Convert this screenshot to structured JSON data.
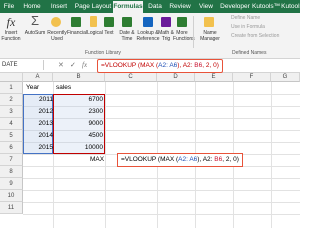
{
  "tabs": [
    "File",
    "Home",
    "Insert",
    "Page Layout",
    "Formulas",
    "Data",
    "Review",
    "View",
    "Developer",
    "Kutools™",
    "Kutools"
  ],
  "active_tab": "Formulas",
  "ribbon": {
    "insert_function": "Insert Function",
    "autosum": "AutoSum",
    "recently_used": "Recently Used",
    "financial": "Financial",
    "logical": "Logical",
    "text": "Text",
    "date_time": "Date & Time",
    "lookup_reference": "Lookup & Reference",
    "math_trig": "Math & Trig",
    "more_functions": "More Functions",
    "name_manager": "Name Manager",
    "function_library": "Function Library",
    "define_name": "Define Name",
    "use_in_formula": "Use in Formula",
    "create_from_selection": "Create from Selection",
    "defined_names": "Defined Names"
  },
  "formula_bar": {
    "name_box": "DATE",
    "cancel": "✕",
    "enter": "✓",
    "fx": "fx",
    "pre": "=VLOOKUP (MAX (",
    "range1": "A2: A6",
    "mid": "), A2: ",
    "range2": "B6",
    "post": ", 2, 0)"
  },
  "columns": [
    "A",
    "B",
    "C",
    "D",
    "E",
    "F",
    "G"
  ],
  "rows": [
    "1",
    "2",
    "3",
    "4",
    "5",
    "6",
    "7",
    "8",
    "9",
    "10",
    "11"
  ],
  "headers": {
    "a1": "Year",
    "b1": "sales"
  },
  "data": [
    {
      "year": "2011",
      "sales": "6700"
    },
    {
      "year": "2012",
      "sales": "2300"
    },
    {
      "year": "2013",
      "sales": "9000"
    },
    {
      "year": "2014",
      "sales": "4500"
    },
    {
      "year": "2015",
      "sales": "10000"
    }
  ],
  "max_label": "MAX",
  "cell_formula": {
    "pre": "=VLOOKUP (MAX (",
    "range1": "A2: A6",
    "mid": "), A2: ",
    "range2": "B6",
    "post": ", 2, 0)"
  }
}
